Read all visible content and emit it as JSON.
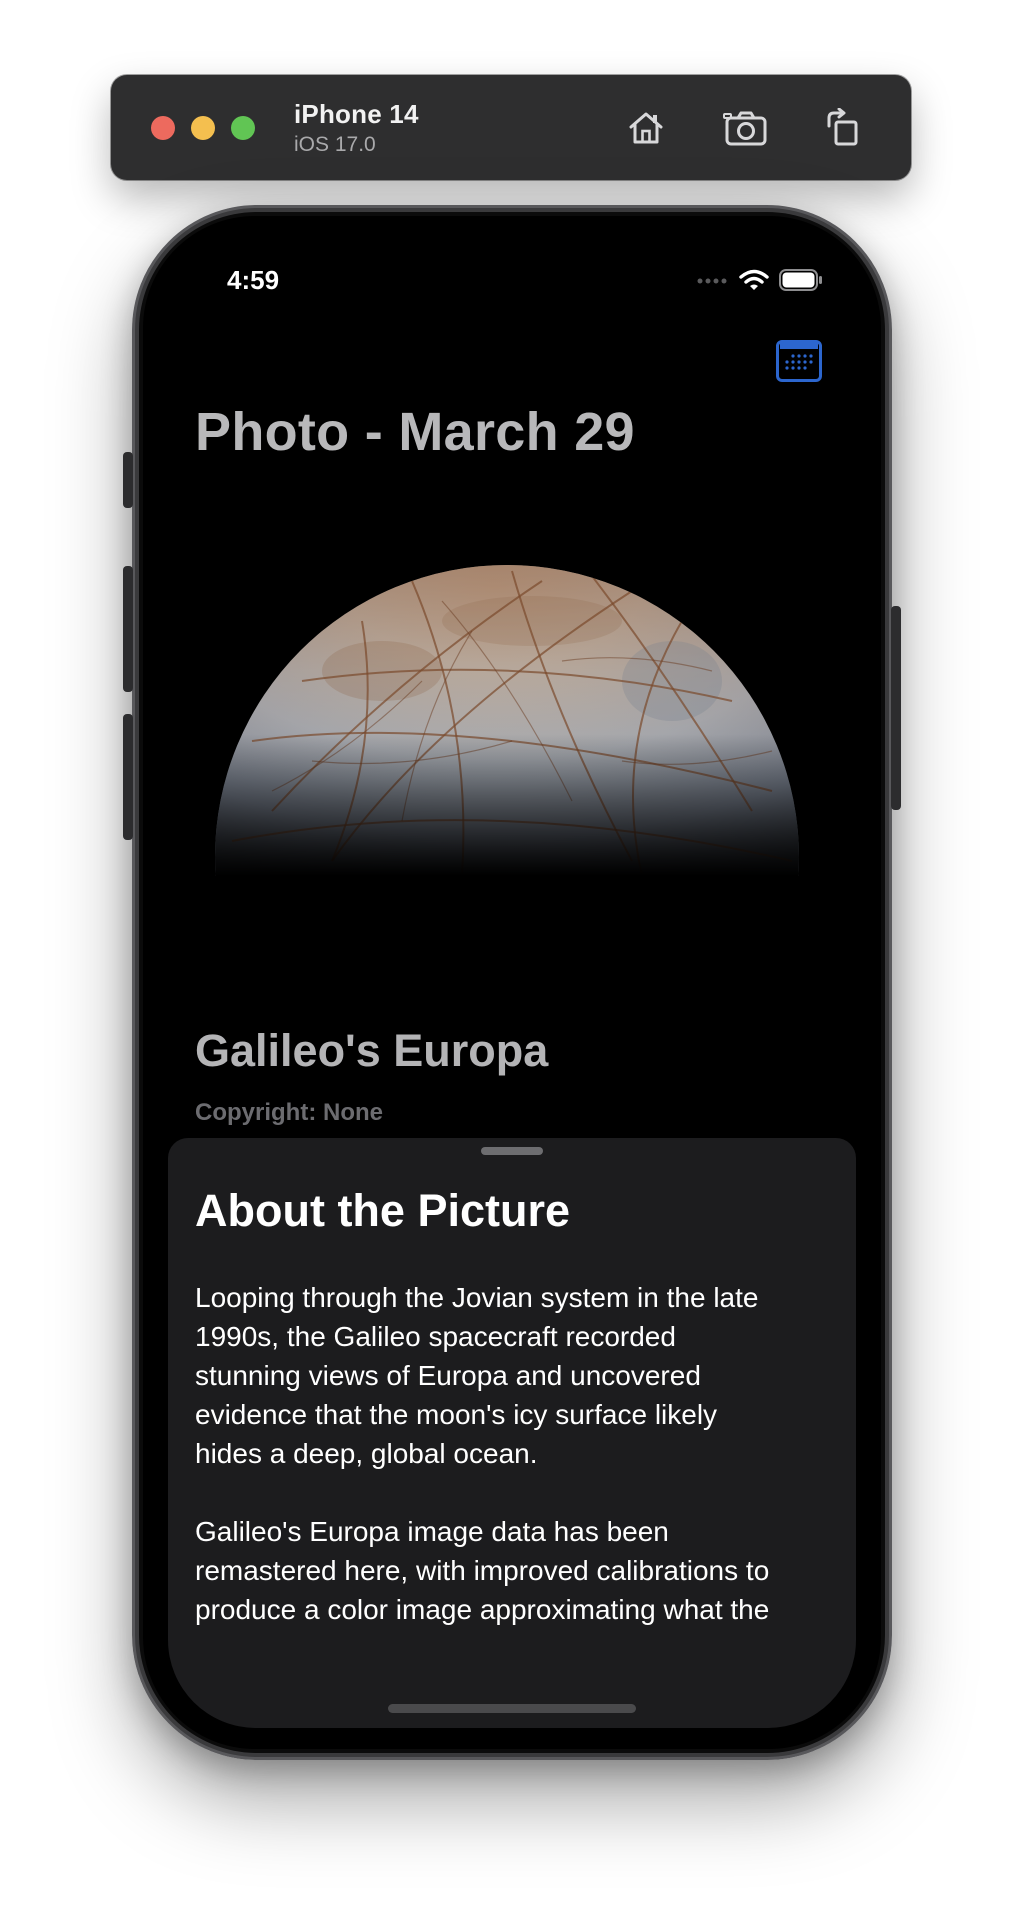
{
  "simulator": {
    "device_name": "iPhone 14",
    "os_version": "iOS 17.0",
    "toolbar_icons": [
      "home-icon",
      "screenshot-icon",
      "rotate-icon"
    ]
  },
  "status_bar": {
    "time": "4:59",
    "icons": [
      "cellular-icon",
      "wifi-icon",
      "battery-icon"
    ]
  },
  "app": {
    "toolbar_icon": "calendar-icon",
    "page_title": "Photo - March 29",
    "photo_title": "Galileo's Europa",
    "copyright": "Copyright: None"
  },
  "sheet": {
    "title": "About the Picture",
    "paragraphs": [
      "Looping through the Jovian system in the late\n1990s, the Galileo spacecraft recorded\nstunning views of Europa and uncovered\nevidence that the moon's icy surface likely\nhides a deep, global ocean.",
      "Galileo's Europa image data has been\nremastered here, with improved calibrations to\nproduce a color image approximating what the"
    ]
  },
  "colors": {
    "accent": "#2c66ce",
    "sheet_background": "#1c1c1e",
    "screen_background": "#000000",
    "toolbar_background": "#2e2e2f"
  }
}
